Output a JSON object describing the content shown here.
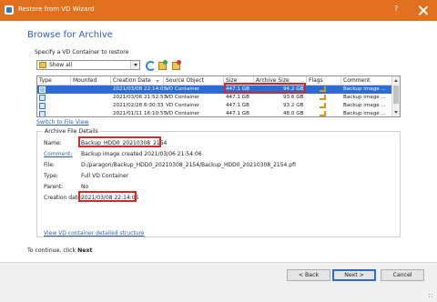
{
  "window": {
    "title": "Restore from VD Wizard",
    "help": "?"
  },
  "page": {
    "title": "Browse for Archive",
    "specify_label": "Specify a VD Container to restore",
    "filter": {
      "value": "Show all"
    }
  },
  "table": {
    "columns": [
      "Type",
      "Mounted",
      "Creation Date",
      "Source Object",
      "Size",
      "Archive Size",
      "Flags",
      "Comment"
    ],
    "rows": [
      {
        "creation_date": "2021/03/08 22:14:05",
        "source": "VD Container",
        "size": "447.1 GB",
        "archive_size": "94.2 GB",
        "comment": "Backup image ...",
        "selected": true
      },
      {
        "creation_date": "2021/03/06 21:52:53",
        "source": "VD Container",
        "size": "447.1 GB",
        "archive_size": "93.6 GB",
        "comment": "Backup image ...",
        "selected": false
      },
      {
        "creation_date": "2021/02/28 6:30:33",
        "source": "VD Container",
        "size": "447.1 GB",
        "archive_size": "93.2 GB",
        "comment": "Backup image ...",
        "selected": false
      },
      {
        "creation_date": "2021/01/11 16:10:55",
        "source": "VD Container",
        "size": "447.1 GB",
        "archive_size": "48.0 GB",
        "comment": "Backup image ...",
        "selected": false
      }
    ]
  },
  "switch_link": "Switch to File View",
  "details": {
    "group_title": "Archive File Details",
    "name_label": "Name:",
    "name_value": "Backup_HDD0_20210308_2154",
    "comment_label": "Comment:",
    "comment_value": "Backup image created 2021/03/06 21:54:06",
    "file_label": "File:",
    "file_value": "D:/paragon/Backup_HDD0_20210308_2154/Backup_HDD0_20210308_2154.pfi",
    "type_label": "Type:",
    "type_value": "Full VD Container",
    "parent_label": "Parent:",
    "parent_value": "No",
    "creation_label": "Creation date:",
    "creation_value": "2021/03/08 22:14:05",
    "structure_link": "View VD container detailed structure"
  },
  "footer": {
    "continue_text": "To continue, click ",
    "continue_bold": "Next",
    "back": "< Back",
    "next": "Next >",
    "cancel": "Cancel"
  },
  "colors": {
    "titlebar": "#e0701d",
    "accent": "#2b6cd6",
    "highlight": "#d22a2a",
    "link": "#2b5fb4"
  }
}
